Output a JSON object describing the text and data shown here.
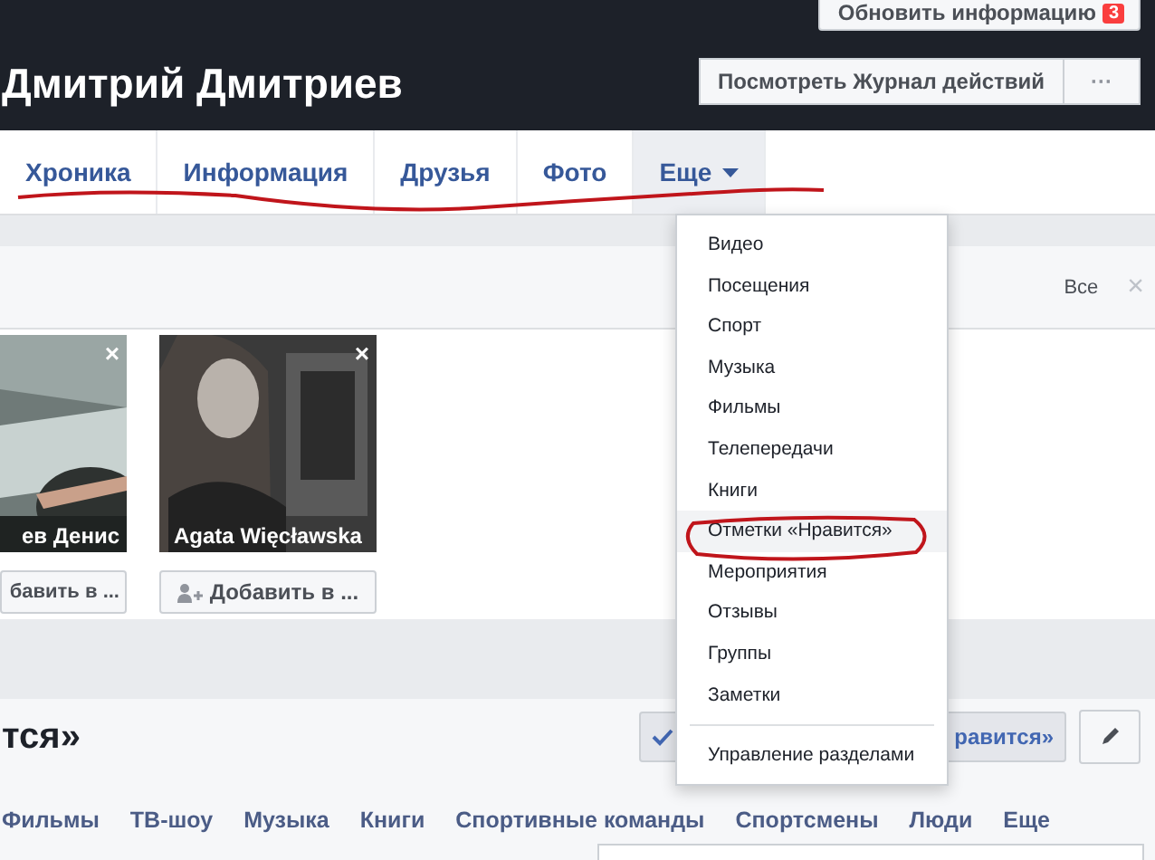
{
  "header": {
    "update_button": "Обновить информацию",
    "update_badge": "3",
    "name": "Дмитрий Дмитриев",
    "activity_button": "Посмотреть Журнал действий",
    "more_button": "···"
  },
  "tabs": [
    {
      "label": "Хроника",
      "selected": false
    },
    {
      "label": "Информация",
      "selected": false
    },
    {
      "label": "Друзья",
      "selected": false
    },
    {
      "label": "Фото",
      "selected": false
    },
    {
      "label": "Еще",
      "selected": true,
      "kind": "dropdown"
    }
  ],
  "menu": {
    "items": [
      {
        "label": "Видео",
        "selected": false
      },
      {
        "label": "Посещения",
        "selected": false
      },
      {
        "label": "Спорт",
        "selected": false
      },
      {
        "label": "Музыка",
        "selected": false
      },
      {
        "label": "Фильмы",
        "selected": false
      },
      {
        "label": "Телепередачи",
        "selected": false
      },
      {
        "label": "Книги",
        "selected": false
      },
      {
        "label": "Отметки «Нравится»",
        "selected": true
      },
      {
        "label": "Мероприятия",
        "selected": false
      },
      {
        "label": "Отзывы",
        "selected": false
      },
      {
        "label": "Группы",
        "selected": false
      },
      {
        "label": "Заметки",
        "selected": false
      }
    ],
    "footer": "Управление разделами"
  },
  "suggestions": {
    "see_all": "Все",
    "close": "×",
    "people": [
      {
        "name": "ев Денис",
        "button": "бавить в ...",
        "kind": "car"
      },
      {
        "name": "Agata Więcławska",
        "button": "Добавить в ...",
        "kind": "portrait"
      }
    ]
  },
  "likes": {
    "title": "тся»",
    "liked_button": "равится»",
    "categories": [
      "Фильмы",
      "ТВ-шоу",
      "Музыка",
      "Книги",
      "Спортивные команды",
      "Спортсмены",
      "Люди",
      "Еще"
    ]
  }
}
